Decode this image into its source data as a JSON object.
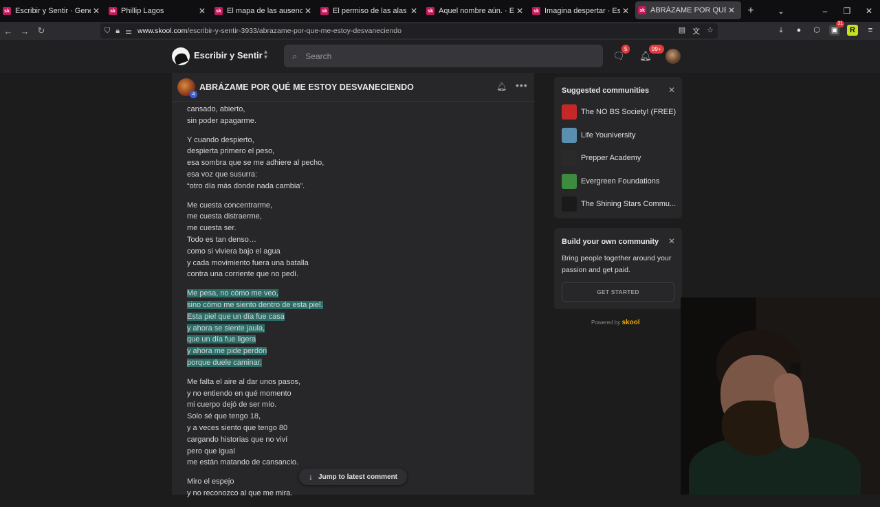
{
  "browser": {
    "tabs": [
      {
        "icon": "sk",
        "title": "Escribir y Sentir · General"
      },
      {
        "icon": "sk",
        "title": "Phillip Lagos"
      },
      {
        "icon": "sk",
        "title": "El mapa de las ausencias I - Escri"
      },
      {
        "icon": "sk",
        "title": "El permiso de las alas que amé."
      },
      {
        "icon": "sk",
        "title": "Aquel nombre aún. · Escribir y S"
      },
      {
        "icon": "sk",
        "title": "Imagina despertar · Escribir y Se"
      },
      {
        "icon": "sk",
        "title": "ABRÁZAME POR QUÉ ME ESTO"
      }
    ],
    "url_domain": "www.skool.com",
    "url_path": "/escribir-y-sentir-3933/abrazame-por-que-me-estoy-desvaneciendo",
    "extension_badge": "31",
    "extension_letter": "R"
  },
  "header": {
    "community_name": "Escribir y Sentir",
    "search_placeholder": "Search",
    "chat_badge": "5",
    "notif_badge": "99+"
  },
  "post": {
    "title": "ABRÁZAME POR QUÉ ME ESTOY DESVANECIENDO",
    "author_level": "4",
    "stanzas": [
      {
        "highlighted": false,
        "lines": [
          "cansado, abierto,",
          "sin poder apagarme."
        ]
      },
      {
        "highlighted": false,
        "lines": [
          "Y cuando despierto,",
          "despierta primero el peso,",
          "esa sombra que se me adhiere al pecho,",
          "esa voz que susurra:",
          "“otro día más donde nada cambia”."
        ]
      },
      {
        "highlighted": false,
        "lines": [
          "Me cuesta concentrarme,",
          "me cuesta distraerme,",
          "me cuesta ser.",
          "Todo es tan denso…",
          "como si viviera bajo el agua",
          "y cada movimiento fuera una batalla",
          "contra una corriente que no pedí."
        ]
      },
      {
        "highlighted": true,
        "lines": [
          "Me pesa, no cómo me veo,",
          "sino cómo me siento dentro de esta piel.",
          "Esta piel que un día fue casa",
          "y ahora se siente jaula,",
          "que un día fue ligera",
          "y ahora me pide perdón",
          "porque duele caminar."
        ]
      },
      {
        "highlighted": false,
        "lines": [
          "Me falta el aire al dar unos pasos,",
          "y no entiendo en qué momento",
          "mi cuerpo dejó de ser mío.",
          "Solo sé que tengo 18,",
          "y a veces siento que tengo 80",
          "cargando historias que no viví",
          "pero que igual",
          "me están matando de cansancio."
        ]
      },
      {
        "highlighted": false,
        "lines": [
          "Miro el espejo",
          "y no reconozco al que me mira."
        ]
      }
    ],
    "jump_label": "Jump to latest comment"
  },
  "sidebar": {
    "suggested_title": "Suggested communities",
    "communities": [
      {
        "name": "The NO BS Society! (FREE)",
        "color": "#c62828"
      },
      {
        "name": "Life Youniversity",
        "color": "#5a8fb0"
      },
      {
        "name": "Prepper Academy",
        "color": "#2a2a2a"
      },
      {
        "name": "Evergreen Foundations",
        "color": "#3d8b3d"
      },
      {
        "name": "The Shining Stars Commu...",
        "color": "#1a1a1a"
      }
    ],
    "build_title": "Build your own community",
    "build_text": "Bring people together around your passion and get paid.",
    "build_button": "GET STARTED",
    "powered_by": "Powered by",
    "powered_brand": "skool"
  }
}
